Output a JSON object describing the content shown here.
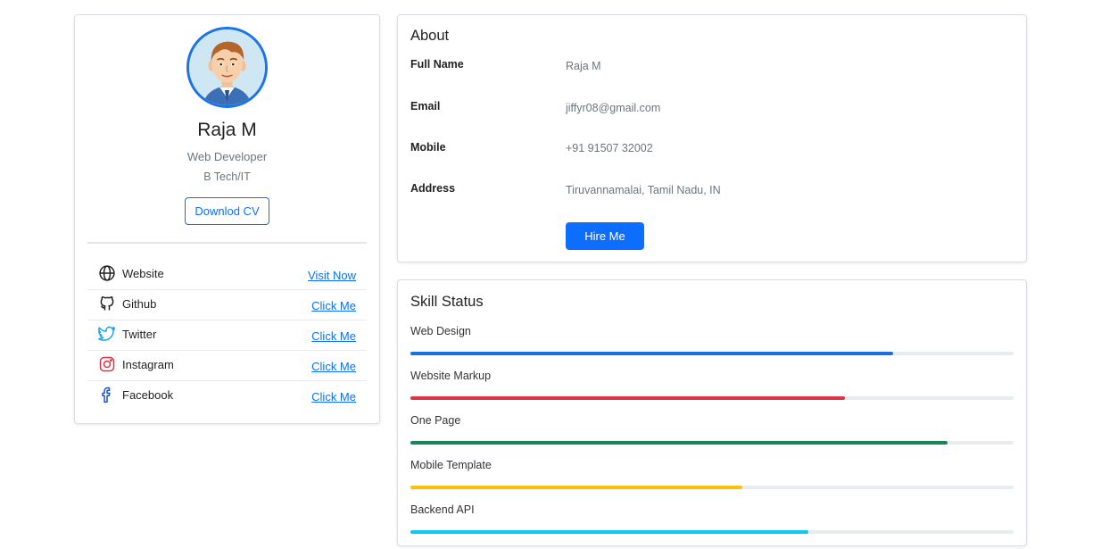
{
  "profile": {
    "name": "Raja M",
    "role": "Web Developer",
    "degree": "B Tech/IT",
    "cv_button": "Downlod CV",
    "links": [
      {
        "label": "Website",
        "action": "Visit Now",
        "icon": "globe-icon"
      },
      {
        "label": "Github",
        "action": "Click Me",
        "icon": "github-icon"
      },
      {
        "label": "Twitter",
        "action": "Click Me",
        "icon": "twitter-icon"
      },
      {
        "label": "Instagram",
        "action": "Click Me",
        "icon": "instagram-icon"
      },
      {
        "label": "Facebook",
        "action": "Click Me",
        "icon": "facebook-icon"
      }
    ]
  },
  "about": {
    "title": "About",
    "rows": [
      {
        "label": "Full Name",
        "value": "Raja M"
      },
      {
        "label": "Email",
        "value": "jiffyr08@gmail.com"
      },
      {
        "label": "Mobile",
        "value": "+91 91507 32002"
      },
      {
        "label": "Address",
        "value": "Tiruvannamalai, Tamil Nadu, IN"
      }
    ],
    "hire_button": "Hire Me"
  },
  "skills": {
    "title": "Skill Status",
    "items": [
      {
        "label": "Web Design",
        "percent": 80,
        "color": "#1a6fdd"
      },
      {
        "label": "Website Markup",
        "percent": 72,
        "color": "#dc3545"
      },
      {
        "label": "One Page",
        "percent": 89,
        "color": "#198754"
      },
      {
        "label": "Mobile Template",
        "percent": 55,
        "color": "#ffc107"
      },
      {
        "label": "Backend API",
        "percent": 66,
        "color": "#0dcaf0"
      }
    ]
  },
  "colors": {
    "primary": "#0d6efd",
    "avatar_ring": "#1a73e8"
  }
}
